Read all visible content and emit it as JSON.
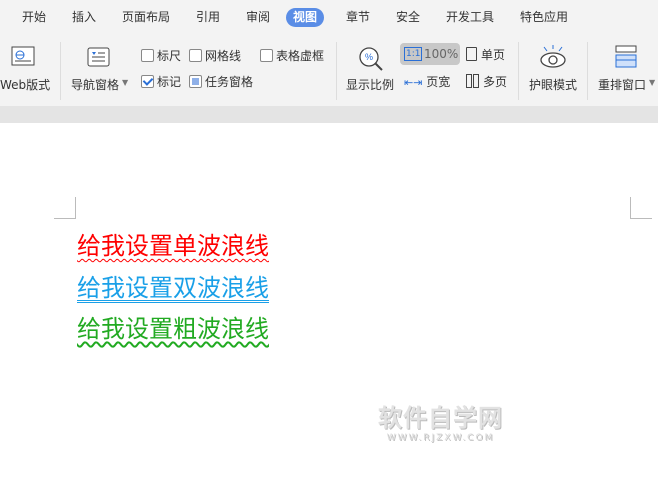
{
  "tabs": [
    {
      "label": "开始"
    },
    {
      "label": "插入"
    },
    {
      "label": "页面布局"
    },
    {
      "label": "引用"
    },
    {
      "label": "审阅"
    },
    {
      "label": "视图",
      "active": true
    },
    {
      "label": "章节"
    },
    {
      "label": "安全"
    },
    {
      "label": "开发工具"
    },
    {
      "label": "特色应用"
    }
  ],
  "ribbon": {
    "web_layout": "Web版式",
    "nav_pane": "导航窗格",
    "ruler": "标尺",
    "gridlines": "网格线",
    "table_gridlines": "表格虚框",
    "marks": "标记",
    "task_pane": "任务窗格",
    "zoom": "显示比例",
    "zoom_100": "100%",
    "zoom_100_icon": "1:1",
    "page_width": "页宽",
    "single_page": "单页",
    "multi_page": "多页",
    "eye_mode": "护眼模式",
    "arrange": "重排窗口"
  },
  "checkboxes": {
    "ruler": false,
    "gridlines": false,
    "table_gridlines": false,
    "marks": true,
    "task_pane": true
  },
  "document": {
    "lines": [
      {
        "text": "给我设置单波浪线",
        "color": "#ff0000"
      },
      {
        "text": "给我设置双波浪线",
        "color": "#1aa0e8"
      },
      {
        "text": "给我设置粗波浪线",
        "color": "#22aa22"
      }
    ]
  },
  "watermark": {
    "title": "软件自学网",
    "url": "WWW.RJZXW.COM"
  }
}
